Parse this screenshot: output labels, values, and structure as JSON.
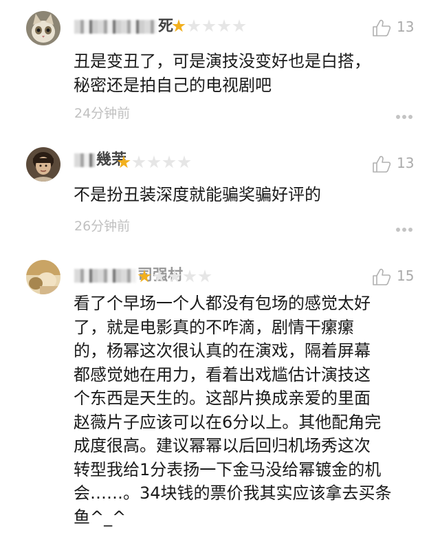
{
  "reviews": [
    {
      "username_visible": "死",
      "rating": 1,
      "max_rating": 5,
      "likes": "13",
      "content": "丑是变丑了，可是演技没变好也是白搭，\n秘密还是拍自己的电视剧吧",
      "time": "24分钟前",
      "avatar": "cat-avatar"
    },
    {
      "username_visible": "幾茉",
      "rating": 1,
      "max_rating": 5,
      "likes": "13",
      "content": "不是扮丑装深度就能骗奖骗好评的",
      "time": "26分钟前",
      "avatar": "portrait-avatar"
    },
    {
      "username_visible": "司强村",
      "rating": 1,
      "max_rating": 5,
      "likes": "15",
      "content": "看了个早场一个人都没有包场的感觉太好\n了，就是电影真的不咋滴，剧情干瘰瘰\n的，杨幂这次很认真的在演戏，隔着屏幕\n都感觉她在用力，看着出戏尴估计演技这\n个东西是天生的。这部片换成亲爱的里面\n赵薇片子应该可以在6分以上。其他配角完\n成度很高。建议幂幂以后回归机场秀这次\n转型我给1分表扬一下金马没给幂镀金的机\n会……。34块钱的票价我其实应该拿去买条\n鱼^_^",
      "avatar": "photo-avatar"
    }
  ],
  "colors": {
    "star_on": "#f2b01e",
    "star_off": "#e6e6e6",
    "meta_text": "#c0c0c0",
    "body_text": "#1a1a1a"
  }
}
